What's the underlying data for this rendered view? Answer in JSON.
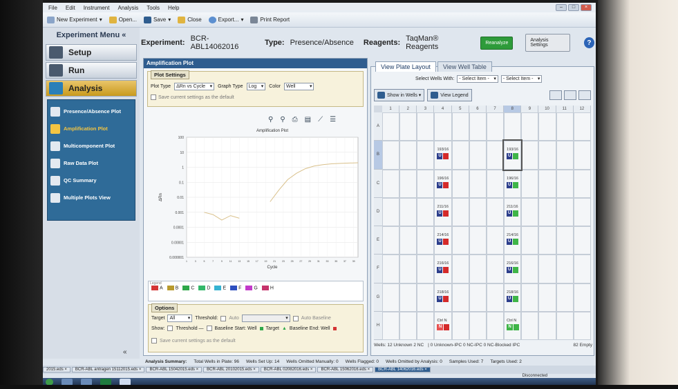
{
  "menubar": [
    "File",
    "Edit",
    "Instrument",
    "Analysis",
    "Tools",
    "Help"
  ],
  "toolbar": {
    "new_experiment": "New Experiment",
    "open": "Open...",
    "save": "Save",
    "close": "Close",
    "export": "Export...",
    "print_report": "Print Report"
  },
  "left_menu": {
    "title": "Experiment Menu «",
    "nav": [
      "Setup",
      "Run",
      "Analysis"
    ],
    "analysis_items": [
      "Presence/Absence Plot",
      "Amplification Plot",
      "Multicomponent Plot",
      "Raw Data Plot",
      "QC Summary",
      "Multiple Plots View"
    ],
    "collapse_label": "«"
  },
  "header": {
    "experiment_label": "Experiment:",
    "experiment_name": "BCR-ABL14062016",
    "type_label": "Type:",
    "type_value": "Presence/Absence",
    "reagents_label": "Reagents:",
    "reagents_value": "TaqMan® Reagents",
    "reanalyze": "Reanalyze",
    "analysis_settings": "Analysis Settings",
    "help": "?"
  },
  "amp_panel": {
    "title": "Amplification Plot",
    "plot_settings_tab": "Plot Settings",
    "plot_type_label": "Plot Type",
    "plot_type_value": "ΔRn vs Cycle",
    "graph_type_label": "Graph Type",
    "graph_type_value": "Log",
    "color_label": "Color",
    "color_value": "Well",
    "save_default": "Save current settings as the default",
    "legend_title": "Legend",
    "legend": [
      {
        "label": "A",
        "color": "#d43434"
      },
      {
        "label": "B",
        "color": "#b89a2e"
      },
      {
        "label": "C",
        "color": "#2fa84a"
      },
      {
        "label": "D",
        "color": "#34b86a"
      },
      {
        "label": "E",
        "color": "#35b3d2"
      },
      {
        "label": "F",
        "color": "#2d4fbf"
      },
      {
        "label": "G",
        "color": "#c23ac9"
      },
      {
        "label": "H",
        "color": "#c6336b"
      }
    ],
    "options_tab": "Options",
    "target_label": "Target",
    "target_value": "All",
    "threshold_label": "Threshold:",
    "auto_label": "Auto",
    "auto_baseline": "Auto Baseline",
    "show_label": "Show:",
    "show_threshold": "Threshold —",
    "show_baseline_start": "Baseline Start: Well",
    "show_target": "Target",
    "show_baseline_end": "Baseline End: Well",
    "options_save_default": "Save current settings as the default"
  },
  "chart_data": {
    "type": "line",
    "title": "Amplification Plot",
    "xlabel": "Cycle",
    "ylabel": "ΔRn",
    "yscale": "log",
    "yticks": [
      "100",
      "10",
      "1",
      "0.1",
      "0.01",
      "0.001",
      "0.0001",
      "0.00001",
      "0.000001"
    ],
    "xticks": [
      "1",
      "3",
      "5",
      "7",
      "9",
      "11",
      "13",
      "15",
      "17",
      "19",
      "21",
      "23",
      "25",
      "27",
      "29",
      "31",
      "33",
      "35",
      "37",
      "39"
    ],
    "xlim": [
      1,
      40
    ],
    "ylim": [
      1e-06,
      100
    ],
    "series": [
      {
        "color": "#d9c08a",
        "x": [
          5,
          7,
          9,
          11,
          13
        ],
        "y": [
          0.001,
          0.0007,
          0.0003,
          0.0006,
          0.0004
        ]
      },
      {
        "color": "#d9c08a",
        "x": [
          20,
          22,
          24,
          26,
          28,
          30,
          32,
          34,
          36,
          38,
          40
        ],
        "y": [
          0.005,
          0.03,
          0.15,
          0.4,
          0.8,
          1.2,
          1.5,
          1.7,
          1.8,
          1.9,
          2.0
        ]
      }
    ],
    "grid": true
  },
  "plate_panel": {
    "tabs": [
      "View Plate Layout",
      "View Well Table"
    ],
    "select_wells_label": "Select Wells With:",
    "select_item_1": "- Select Item -",
    "select_item_2": "- Select Item -",
    "show_in_wells": "Show in Wells ▾",
    "view_legend": "View Legend",
    "columns": [
      "1",
      "2",
      "3",
      "4",
      "5",
      "6",
      "7",
      "8",
      "9",
      "10",
      "11",
      "12"
    ],
    "rows": [
      "A",
      "B",
      "C",
      "D",
      "E",
      "F",
      "G",
      "H"
    ],
    "samples": [
      {
        "label": "193/16",
        "type": "U",
        "status": "red"
      },
      {
        "label": "193/16",
        "type": "U",
        "status": "green",
        "selected": true
      },
      {
        "label": "196/16",
        "type": "U",
        "status": "red"
      },
      {
        "label": "196/16",
        "type": "U",
        "status": "green"
      },
      {
        "label": "211/16",
        "type": "U",
        "status": "red"
      },
      {
        "label": "211/16",
        "type": "U",
        "status": "green"
      },
      {
        "label": "214/16",
        "type": "U",
        "status": "red"
      },
      {
        "label": "214/16",
        "type": "U",
        "status": "green"
      },
      {
        "label": "216/16",
        "type": "U",
        "status": "red"
      },
      {
        "label": "216/16",
        "type": "U",
        "status": "green"
      },
      {
        "label": "218/16",
        "type": "U",
        "status": "red"
      },
      {
        "label": "218/16",
        "type": "U",
        "status": "green"
      },
      {
        "label": "Ctrl N",
        "type": "N",
        "status": "red"
      },
      {
        "label": "Ctrl N",
        "type": "N",
        "status": "green"
      }
    ],
    "footer": [
      "Wells: 12 Unknown 2 NC",
      "| 0 Unknown-IPC 0 NC-IPC 0 NC-Blocked IPC",
      "82 Empty"
    ]
  },
  "summary": {
    "label": "Analysis Summary:",
    "items": [
      "Total Wells in Plate: 96",
      "Wells Set Up: 14",
      "Wells Omitted Manually: 0",
      "Wells Flagged: 0",
      "Wells Omitted by Analysis: 0",
      "Samples Used: 7",
      "Targets Used: 2"
    ]
  },
  "file_tabs": [
    "2015.eds ×",
    "BCR-ABL antragen 15112015.eds ×",
    "BCR-ABL 15042015.eds ×",
    "BCR-ABL 20102015.eds ×",
    "BCR-ABL 02082016.eds ×",
    "BCR-ABL 15062016.eds ×",
    "BCR-ABL 14062016.eds ×"
  ],
  "status": "Disconnected"
}
